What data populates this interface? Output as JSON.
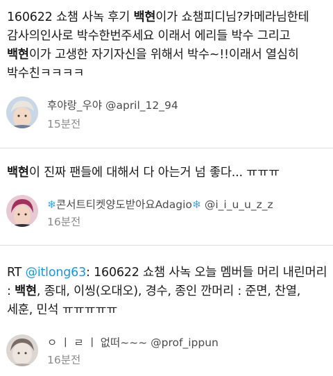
{
  "tweets": [
    {
      "body_parts": [
        {
          "text": "160622 쇼챔 사녹 후기 ",
          "style": "normal"
        },
        {
          "text": "백현",
          "style": "bold"
        },
        {
          "text": "이가 쇼챔피디님?카메라님한테 감사의인사로 박수한번주세요 이래서 에리들 박수 그리고 ",
          "style": "normal"
        },
        {
          "text": "백현",
          "style": "bold"
        },
        {
          "text": "이가 고생한 자기자신을 위해서 박수~!!이래서 열심히 박수친ㅋㅋㅋㅋ",
          "style": "normal"
        }
      ],
      "author": "후야랑_우야 @april_12_94",
      "time": "15분전"
    },
    {
      "body_parts": [
        {
          "text": "백현",
          "style": "bold"
        },
        {
          "text": "이 진짜 팬들에 대해서 다 아는거 넘 좋다... ㅠㅠㅠ",
          "style": "normal"
        }
      ],
      "author_prefix_icon": "snowflake-icon",
      "author_name": "콘서트티켓양도받아요Adagio",
      "author_suffix_icon": "snowflake-icon",
      "author_handle": "@i_i_u_u_z_z",
      "time": "16분전"
    },
    {
      "body_parts": [
        {
          "text": "RT ",
          "style": "normal"
        },
        {
          "text": "@itlong63",
          "style": "mention"
        },
        {
          "text": ": 160622 쇼챔 사녹 오늘 멤버들 머리 내린머리 : ",
          "style": "normal"
        },
        {
          "text": "백현",
          "style": "bold"
        },
        {
          "text": ", 종대, 이씽(오대오), 경수, 종인 깐머리 : 준면, 찬열, 세훈, 민석 ㅠㅠㅠㅠㅠ",
          "style": "normal"
        }
      ],
      "author": "ㅇ ㅣ ㄹ ㅣ 없떠~~~ @prof_ippun",
      "time": "16분전"
    }
  ],
  "icons": {
    "snowflake": "❄"
  },
  "colors": {
    "mention": "#1b95e0",
    "divider": "#dcdcdc",
    "time": "#8a8a8a"
  }
}
